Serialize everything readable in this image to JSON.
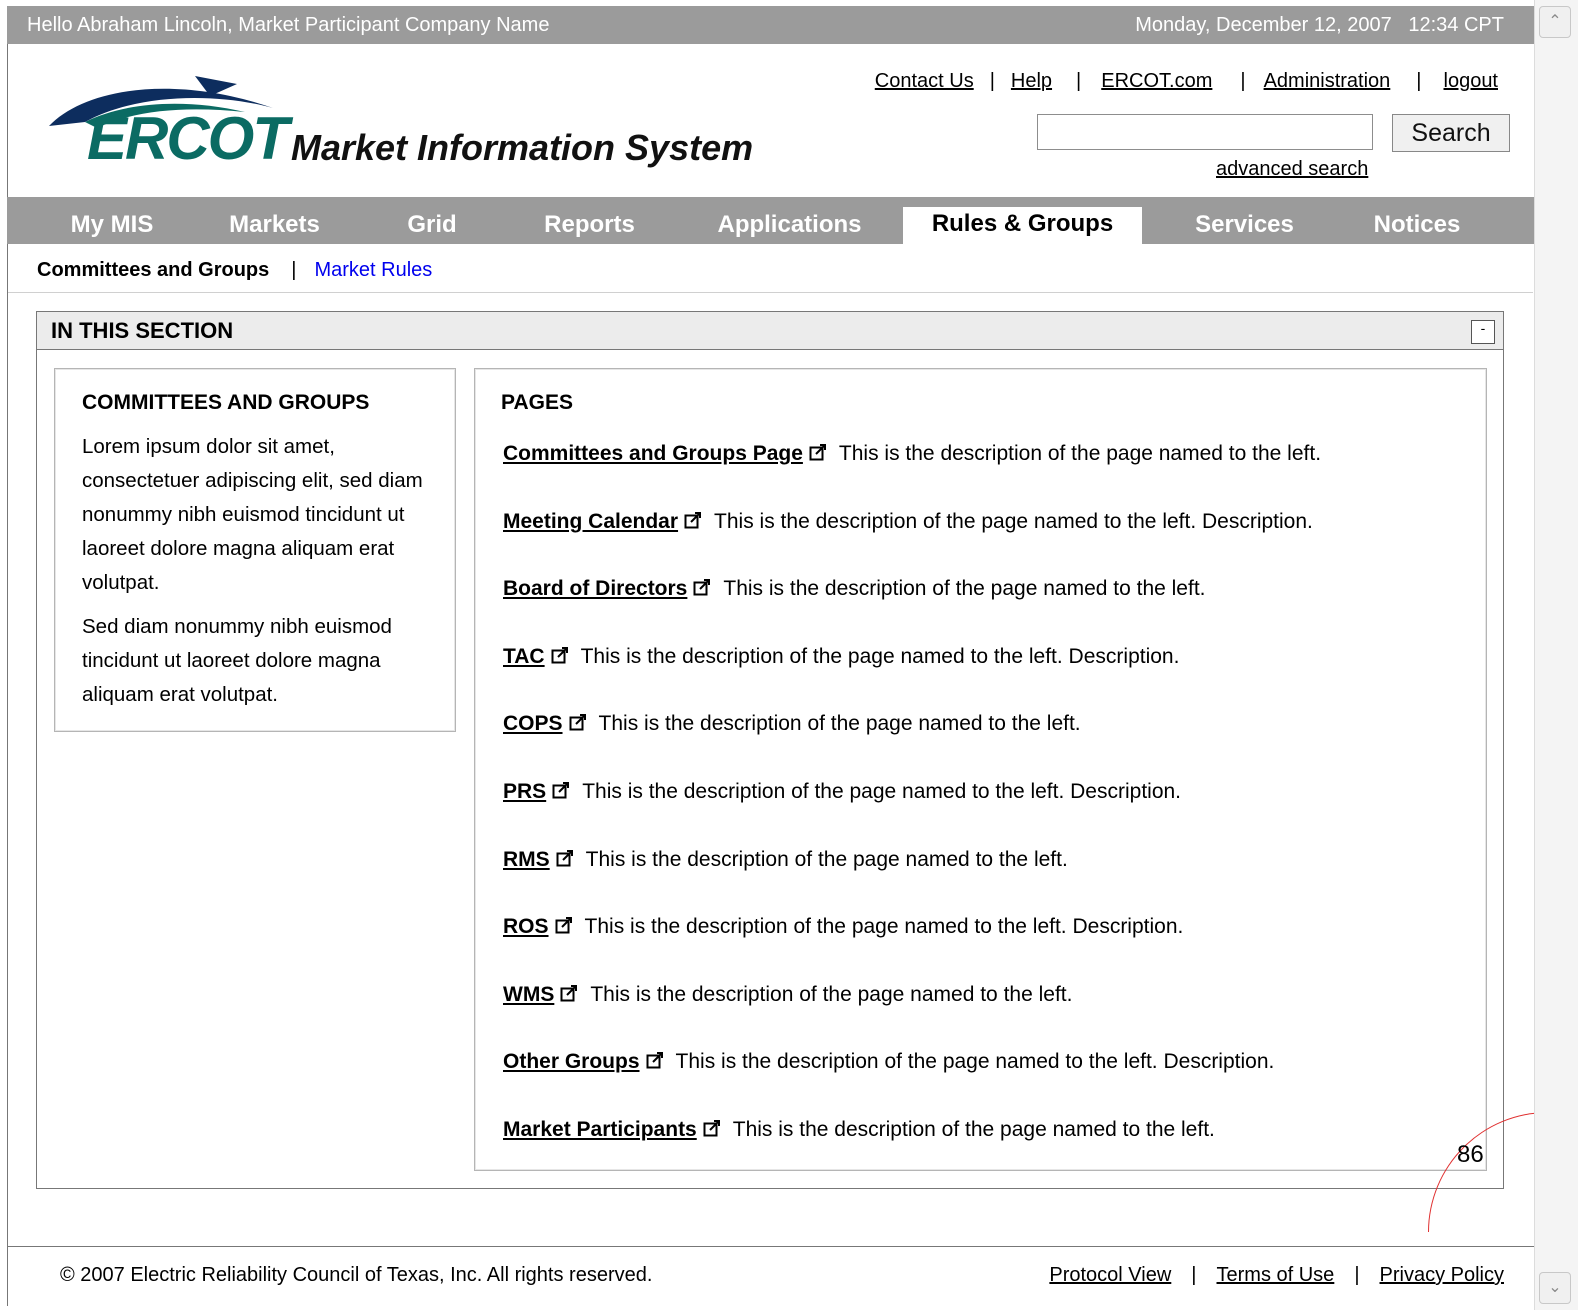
{
  "topbar": {
    "greeting": "Hello Abraham Lincoln, Market Participant Company Name",
    "datetime": "Monday, December 12, 2007   12:34 CPT"
  },
  "header": {
    "logo_text": "ERCOT",
    "system_title": "Market Information System",
    "util_links": [
      "Contact Us",
      "Help",
      "ERCOT.com",
      "Administration",
      "logout"
    ],
    "separator": "|",
    "search_placeholder": "",
    "search_button": "Search",
    "advanced_search": "advanced search"
  },
  "colors": {
    "bar_gray": "#9b9b9b",
    "logo_teal": "#0b6b63",
    "logo_navy": "#0d2d5e",
    "link_blue": "#0000ee",
    "annotation_red": "#e03030"
  },
  "nav": {
    "tabs": [
      "My MIS",
      "Markets",
      "Grid",
      "Reports",
      "Applications",
      "Rules & Groups",
      "Services",
      "Notices"
    ],
    "active": "Rules & Groups"
  },
  "subnav": {
    "current": "Committees and Groups",
    "separator": "|",
    "link": "Market Rules"
  },
  "section": {
    "title": "IN THIS SECTION",
    "collapse_label": "-",
    "left": {
      "title": "COMMITTEES AND GROUPS",
      "para1": "Lorem ipsum dolor sit amet, consectetuer adipiscing elit, sed diam nonummy nibh euismod tincidunt ut laoreet dolore magna aliquam erat volutpat.",
      "para2": "Sed diam nonummy nibh euismod tincidunt ut laoreet dolore magna aliquam erat volutpat."
    },
    "pages_title": "PAGES",
    "pages": [
      {
        "name": "Committees and Groups Page",
        "description": "This is the description of the page named to the left.",
        "icon": "external-link-icon"
      },
      {
        "name": "Meeting Calendar",
        "description": "This is the description of the page named to the left. Description.",
        "icon": "external-link-icon"
      },
      {
        "name": "Board of Directors",
        "description": "This is the description of the page named to the left.",
        "icon": "external-link-icon"
      },
      {
        "name": "TAC",
        "description": "This is the description of the page named to the left. Description.",
        "icon": "external-link-icon"
      },
      {
        "name": "COPS",
        "description": "This is the description of the page named to the left.",
        "icon": "external-link-icon"
      },
      {
        "name": "PRS",
        "description": "This is the description of the page named to the left. Description.",
        "icon": "external-link-icon"
      },
      {
        "name": "RMS",
        "description": "This is the description of the page named to the left.",
        "icon": "external-link-icon"
      },
      {
        "name": "ROS",
        "description": "This is the description of the page named to the left. Description.",
        "icon": "external-link-icon"
      },
      {
        "name": "WMS",
        "description": "This is the description of the page named to the left.",
        "icon": "external-link-icon"
      },
      {
        "name": "Other Groups",
        "description": "This is the description of the page named to the left. Description.",
        "icon": "external-link-icon"
      },
      {
        "name": "Market Participants",
        "description": "This is the description of the page named to the left.",
        "icon": "external-link-icon"
      }
    ]
  },
  "page_number": "86",
  "footer": {
    "copyright": "© 2007 Electric Reliability Council of Texas, Inc.  All rights reserved.",
    "links": [
      "Protocol View",
      "Terms of Use",
      "Privacy Policy"
    ],
    "separator": "|"
  },
  "scrollbar": {
    "up_icon": "chevron-up-icon",
    "down_icon": "chevron-down-icon"
  }
}
